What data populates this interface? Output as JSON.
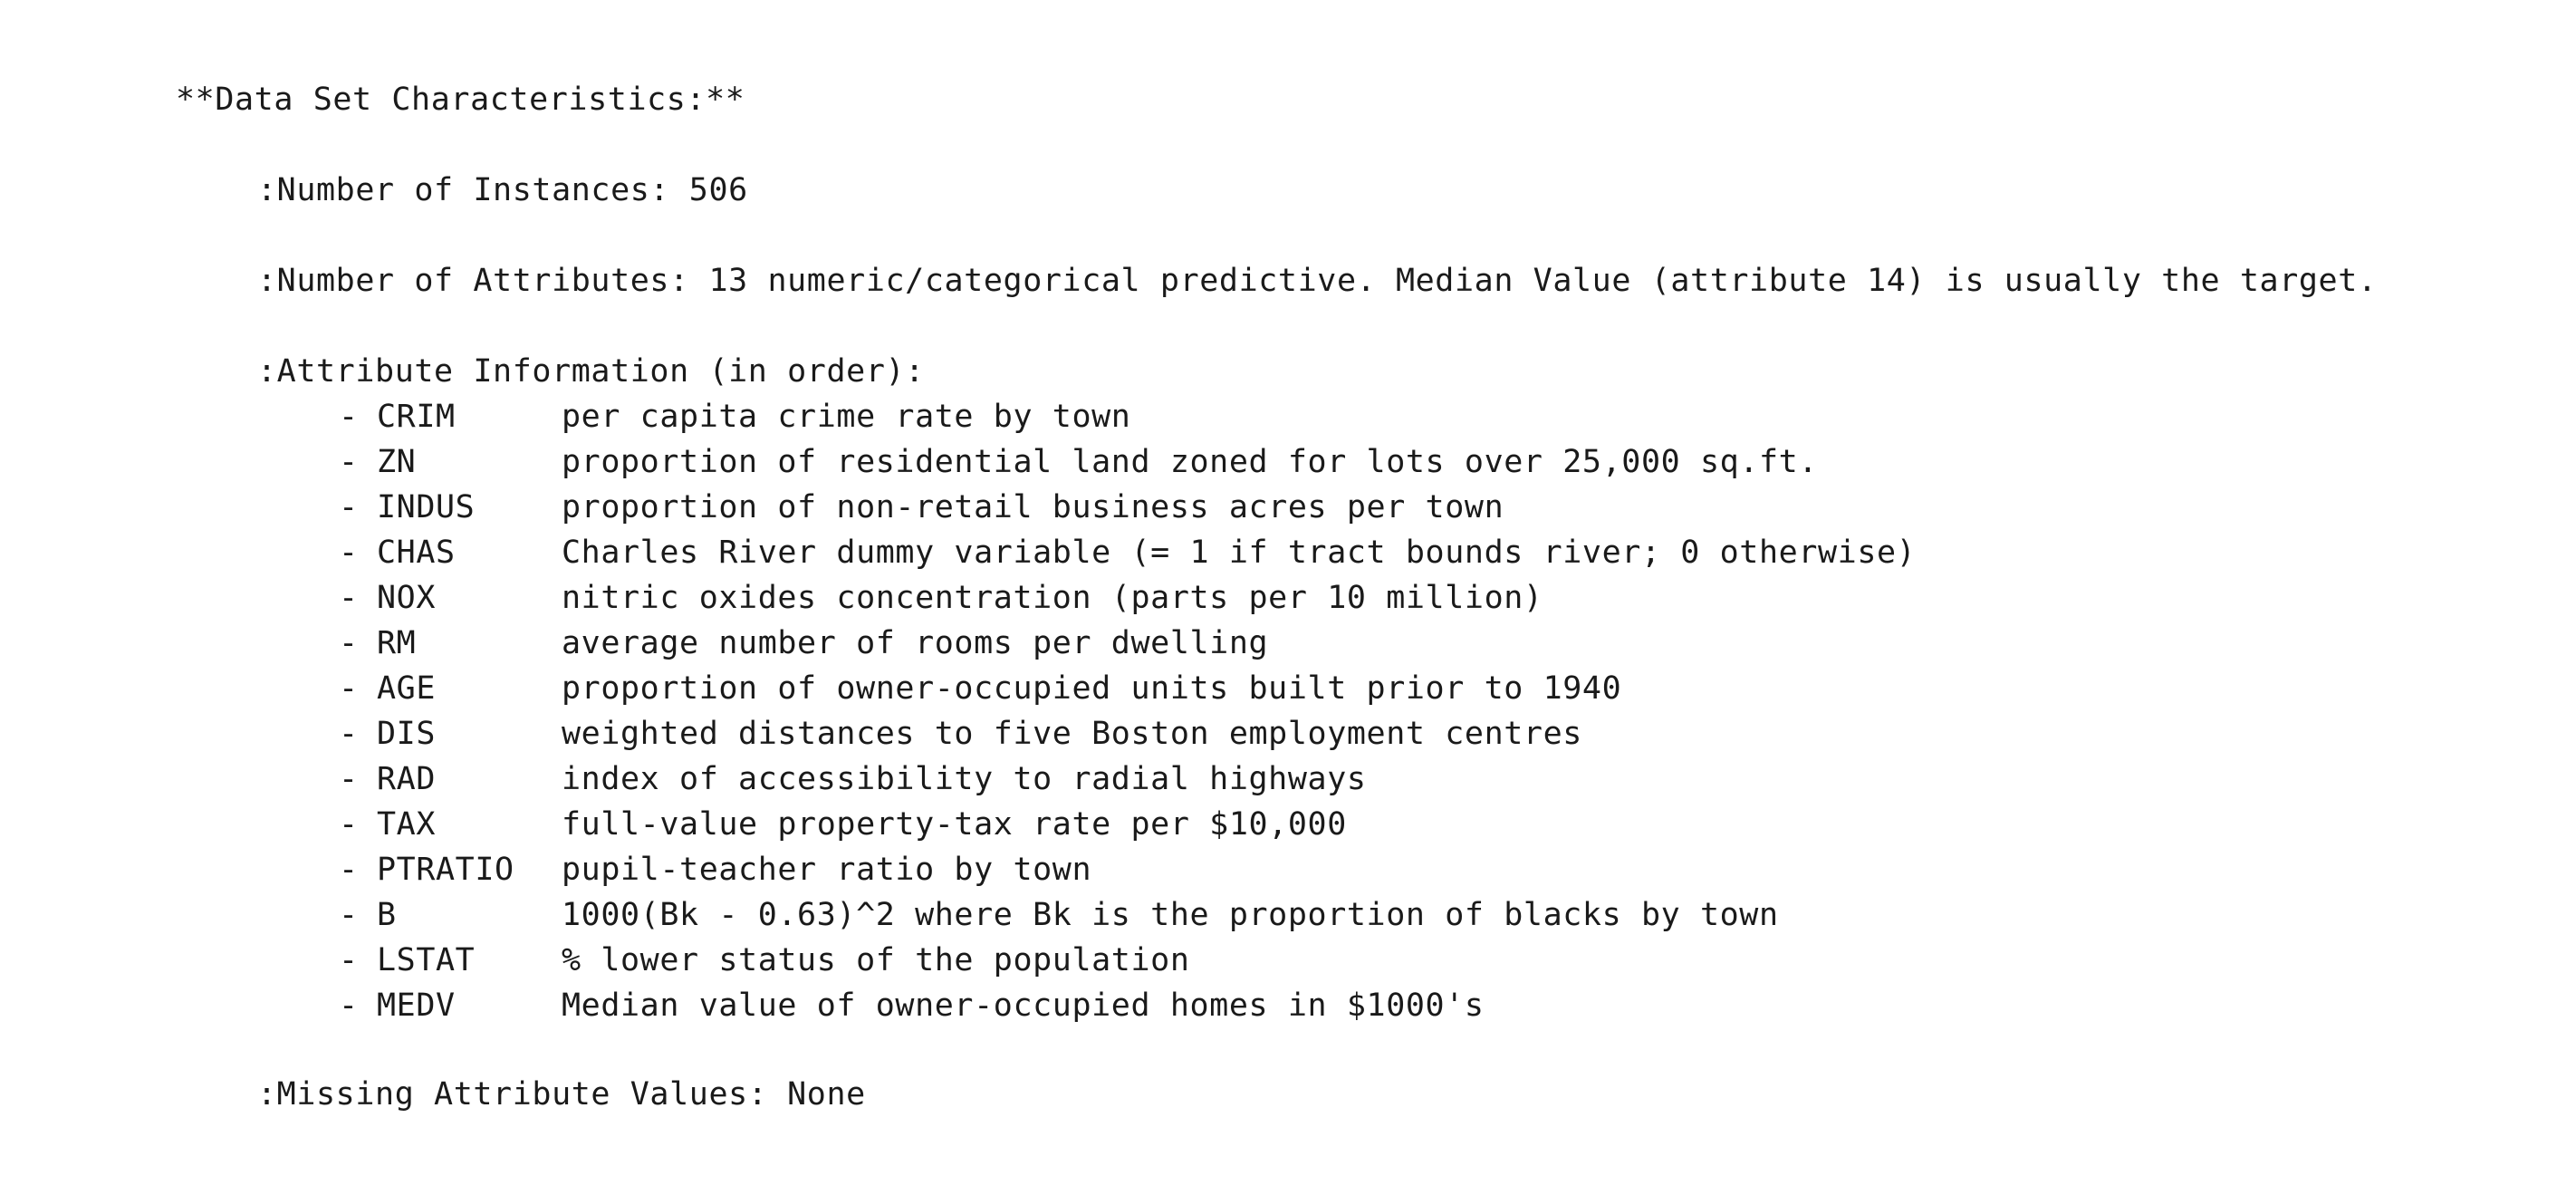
{
  "heading": "**Data Set Characteristics:**",
  "instances": ":Number of Instances: 506",
  "attributes_count": ":Number of Attributes: 13 numeric/categorical predictive. Median Value (attribute 14) is usually the target.",
  "attribute_info_header": ":Attribute Information (in order):",
  "attributes": [
    {
      "dash": "-",
      "code": "CRIM",
      "desc": "per capita crime rate by town"
    },
    {
      "dash": "-",
      "code": "ZN",
      "desc": "proportion of residential land zoned for lots over 25,000 sq.ft."
    },
    {
      "dash": "-",
      "code": "INDUS",
      "desc": "proportion of non-retail business acres per town"
    },
    {
      "dash": "-",
      "code": "CHAS",
      "desc": "Charles River dummy variable (= 1 if tract bounds river; 0 otherwise)"
    },
    {
      "dash": "-",
      "code": "NOX",
      "desc": "nitric oxides concentration (parts per 10 million)"
    },
    {
      "dash": "-",
      "code": "RM",
      "desc": "average number of rooms per dwelling"
    },
    {
      "dash": "-",
      "code": "AGE",
      "desc": "proportion of owner-occupied units built prior to 1940"
    },
    {
      "dash": "-",
      "code": "DIS",
      "desc": "weighted distances to five Boston employment centres"
    },
    {
      "dash": "-",
      "code": "RAD",
      "desc": "index of accessibility to radial highways"
    },
    {
      "dash": "-",
      "code": "TAX",
      "desc": "full-value property-tax rate per $10,000"
    },
    {
      "dash": "-",
      "code": "PTRATIO",
      "desc": "pupil-teacher ratio by town"
    },
    {
      "dash": "-",
      "code": "B",
      "desc": "1000(Bk - 0.63)^2 where Bk is the proportion of blacks by town"
    },
    {
      "dash": "-",
      "code": "LSTAT",
      "desc": "% lower status of the population"
    },
    {
      "dash": "-",
      "code": "MEDV",
      "desc": "Median value of owner-occupied homes in $1000's"
    }
  ],
  "missing_values": ":Missing Attribute Values: None"
}
